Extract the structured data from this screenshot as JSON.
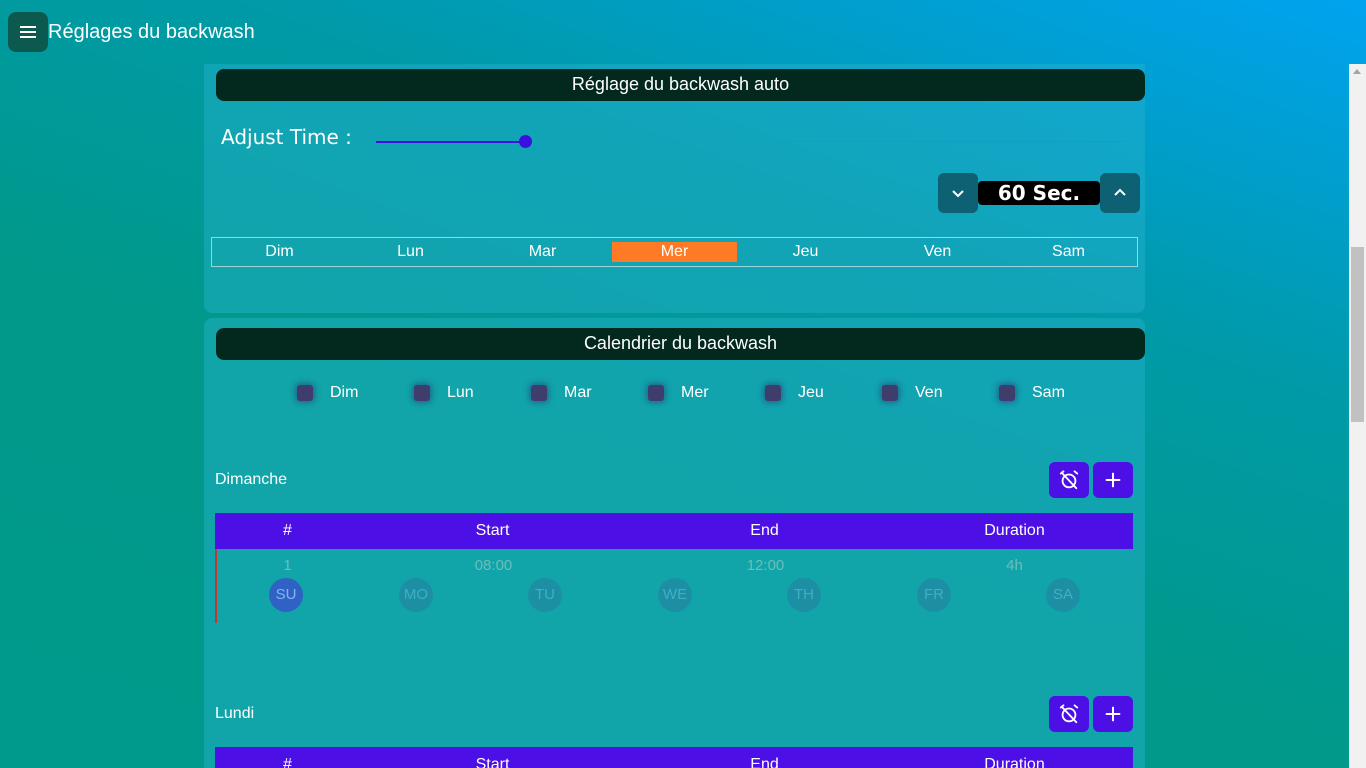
{
  "header": {
    "title": "Réglages du backwash",
    "menu_icon": "hamburger-menu-icon"
  },
  "auto_section": {
    "title": "Réglage du backwash auto",
    "adjust_label": "Adjust Time :",
    "slider_fraction": 0.2,
    "time_value": "60 Sec.",
    "days": [
      "Dim",
      "Lun",
      "Mar",
      "Mer",
      "Jeu",
      "Ven",
      "Sam"
    ],
    "active_day": "Mer",
    "active_color": "#ff7a24"
  },
  "calendar_section": {
    "title": "Calendrier du backwash",
    "day_checkboxes": [
      "Dim",
      "Lun",
      "Mar",
      "Mer",
      "Jeu",
      "Ven",
      "Sam"
    ],
    "table_columns": [
      "#",
      "Start",
      "End",
      "Duration"
    ],
    "weekday_initials": [
      "SU",
      "MO",
      "TU",
      "WE",
      "TH",
      "FR",
      "SA"
    ],
    "days": [
      {
        "name": "Dimanche",
        "rows": [
          {
            "index": "1",
            "start": "08:00",
            "end": "12:00",
            "duration": "4h",
            "active_days": [
              "SU"
            ]
          }
        ]
      },
      {
        "name": "Lundi",
        "rows": []
      }
    ],
    "accent_color": "#4c0fe6"
  }
}
